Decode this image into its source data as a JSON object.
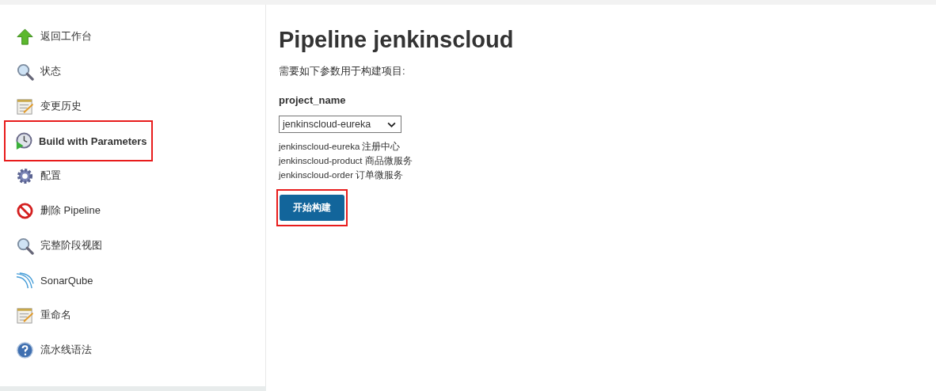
{
  "sidebar": {
    "items": [
      {
        "label": "返回工作台",
        "kind": "back",
        "highlighted": false
      },
      {
        "label": "状态",
        "kind": "status",
        "highlighted": false
      },
      {
        "label": "变更历史",
        "kind": "changes",
        "highlighted": false
      },
      {
        "label": "Build with Parameters",
        "kind": "build",
        "highlighted": true
      },
      {
        "label": "配置",
        "kind": "configure",
        "highlighted": false
      },
      {
        "label": "删除 Pipeline",
        "kind": "delete",
        "highlighted": false
      },
      {
        "label": "完整阶段视图",
        "kind": "status",
        "highlighted": false
      },
      {
        "label": "SonarQube",
        "kind": "sonar",
        "highlighted": false
      },
      {
        "label": "重命名",
        "kind": "changes",
        "highlighted": false
      },
      {
        "label": "流水线语法",
        "kind": "help",
        "highlighted": false
      }
    ]
  },
  "main": {
    "title": "Pipeline jenkinscloud",
    "intro": "需要如下参数用于构建项目:",
    "parameter": {
      "name": "project_name",
      "value": "jenkinscloud-eureka",
      "description": [
        "jenkinscloud-eureka 注册中心",
        "jenkinscloud-product 商品微服务",
        "jenkinscloud-order 订单微服务"
      ]
    },
    "build_button": {
      "label": "开始构建",
      "highlighted": true
    }
  }
}
